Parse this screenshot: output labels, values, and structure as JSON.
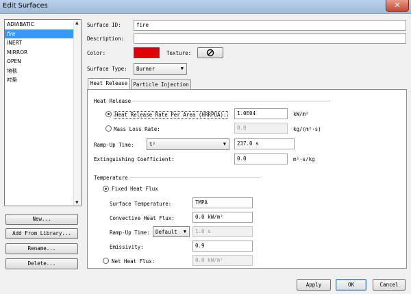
{
  "window": {
    "title": "Edit Surfaces",
    "close_glyph": "✕"
  },
  "surfaces": {
    "items": [
      {
        "label": "ADIABATIC",
        "selected": false
      },
      {
        "label": "fire",
        "selected": true
      },
      {
        "label": "INERT",
        "selected": false
      },
      {
        "label": "MIRROR",
        "selected": false
      },
      {
        "label": "OPEN",
        "selected": false
      },
      {
        "label": "地毯",
        "selected": false
      },
      {
        "label": "衬垫",
        "selected": false
      }
    ]
  },
  "side_buttons": {
    "new": "New...",
    "add_from_library": "Add From Library...",
    "rename": "Rename...",
    "delete": "Delete..."
  },
  "props": {
    "surface_id_label": "Surface ID:",
    "surface_id_value": "fire",
    "description_label": "Description:",
    "description_value": "",
    "color_label": "Color:",
    "color_value": "#e00000",
    "texture_label": "Texture:",
    "surface_type_label": "Surface Type:",
    "surface_type_value": "Burner"
  },
  "tabs": [
    {
      "label": "Heat Release",
      "active": true
    },
    {
      "label": "Particle Injection",
      "active": false
    }
  ],
  "heat_release": {
    "section_label": "Heat Release",
    "hrrpua_label": "Heat Release Rate Per Area (HRRPUA):",
    "hrrpua_value": "1.0E04",
    "hrrpua_unit": "kW/m²",
    "mlr_label": "Mass Loss Rate:",
    "mlr_value": "0.0",
    "mlr_unit": "kg/(m²·s)",
    "rampup_label": "Ramp-Up Time:",
    "rampup_mode": "t²",
    "rampup_value": "237.0 s",
    "ext_label": "Extinguishing Coefficient:",
    "ext_value": "0.0",
    "ext_unit": "m²·s/kg"
  },
  "temperature": {
    "section_label": "Temperature",
    "fixed_label": "Fixed Heat Flux",
    "surf_temp_label": "Surface Temperature:",
    "surf_temp_value": "TMPA",
    "conv_label": "Convective Heat Flux:",
    "conv_value": "0.0 kW/m²",
    "rampup_label": "Ramp-Up Time:",
    "rampup_mode": "Default",
    "rampup_value": "1.0 s",
    "emissivity_label": "Emissivity:",
    "emissivity_value": "0.9",
    "net_label": "Net Heat Flux:",
    "net_value": "0.0 kW/m²"
  },
  "footer": {
    "apply": "Apply",
    "ok": "OK",
    "cancel": "Cancel"
  }
}
